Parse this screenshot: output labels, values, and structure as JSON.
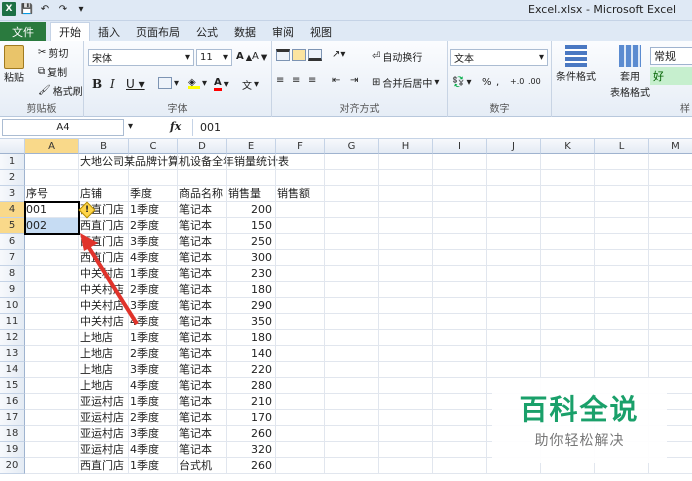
{
  "window": {
    "title": "Excel.xlsx - Microsoft Excel"
  },
  "tabs": [
    "文件",
    "开始",
    "插入",
    "页面布局",
    "公式",
    "数据",
    "审阅",
    "视图"
  ],
  "ribbon": {
    "clipboard": {
      "paste": "粘贴",
      "cut": "剪切",
      "copy": "复制",
      "format_painter": "格式刷",
      "label": "剪贴板"
    },
    "font": {
      "name": "宋体",
      "size": "11",
      "label": "字体"
    },
    "alignment": {
      "wrap": "自动换行",
      "merge": "合并后居中",
      "label": "对齐方式"
    },
    "number": {
      "format": "文本",
      "percent": "%",
      "comma": ",",
      "label": "数字"
    },
    "styles": {
      "conditional": "条件格式",
      "table": "套用",
      "table2": "表格格式",
      "normal": "常规",
      "good": "好",
      "label": "样"
    }
  },
  "formula_bar": {
    "name_box": "A4",
    "fx": "fx",
    "value": "001"
  },
  "columns": [
    "A",
    "B",
    "C",
    "D",
    "E",
    "F",
    "G",
    "H",
    "I",
    "J",
    "K",
    "L",
    "M"
  ],
  "rows": [
    [
      "",
      "大地公司某品牌计算机设备全年销量统计表",
      "",
      "",
      "",
      ""
    ],
    [
      "",
      "",
      "",
      "",
      "",
      ""
    ],
    [
      "序号",
      "店铺",
      "季度",
      "商品名称",
      "销售量",
      "销售额"
    ],
    [
      "001",
      "西直门店",
      "1季度",
      "笔记本",
      "200",
      ""
    ],
    [
      "002",
      "西直门店",
      "2季度",
      "笔记本",
      "150",
      ""
    ],
    [
      "",
      "西直门店",
      "3季度",
      "笔记本",
      "250",
      ""
    ],
    [
      "",
      "西直门店",
      "4季度",
      "笔记本",
      "300",
      ""
    ],
    [
      "",
      "中关村店",
      "1季度",
      "笔记本",
      "230",
      ""
    ],
    [
      "",
      "中关村店",
      "2季度",
      "笔记本",
      "180",
      ""
    ],
    [
      "",
      "中关村店",
      "3季度",
      "笔记本",
      "290",
      ""
    ],
    [
      "",
      "中关村店",
      "4季度",
      "笔记本",
      "350",
      ""
    ],
    [
      "",
      "上地店",
      "1季度",
      "笔记本",
      "180",
      ""
    ],
    [
      "",
      "上地店",
      "2季度",
      "笔记本",
      "140",
      ""
    ],
    [
      "",
      "上地店",
      "3季度",
      "笔记本",
      "220",
      ""
    ],
    [
      "",
      "上地店",
      "4季度",
      "笔记本",
      "280",
      ""
    ],
    [
      "",
      "亚运村店",
      "1季度",
      "笔记本",
      "210",
      ""
    ],
    [
      "",
      "亚运村店",
      "2季度",
      "笔记本",
      "170",
      ""
    ],
    [
      "",
      "亚运村店",
      "3季度",
      "笔记本",
      "260",
      ""
    ],
    [
      "",
      "亚运村店",
      "4季度",
      "笔记本",
      "320",
      ""
    ],
    [
      "",
      "西直门店",
      "1季度",
      "台式机",
      "260",
      ""
    ]
  ],
  "watermark": {
    "big": "百科全说",
    "small": "助你轻松解决"
  },
  "colors": {
    "accent": "#2a7a3e",
    "selection": "#c6dcf3",
    "arrow": "#e0332b"
  }
}
